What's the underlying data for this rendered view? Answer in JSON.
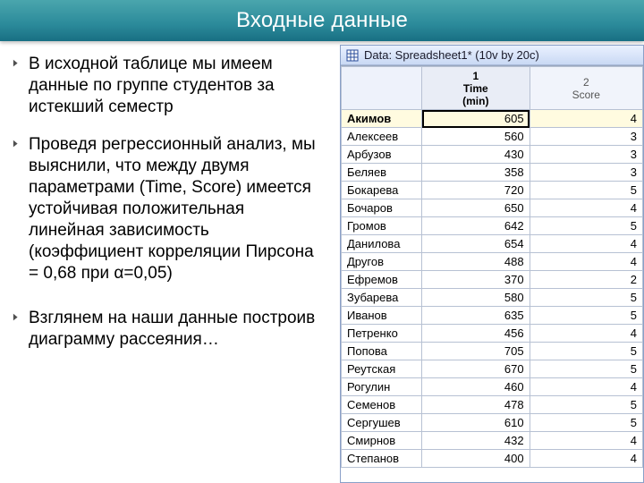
{
  "title": "Входные данные",
  "bullets": {
    "b1": "В исходной таблице мы имеем данные по группе студентов за истекший семестр",
    "b2": "Проведя регрессионный анализ, мы выяснили, что между двумя параметрами (Time, Score) имеется устойчивая положительная линейная зависимость (коэффициент корреляции Пирсона = 0,68 при α=0,05)",
    "b3": "Взглянем на наши данные построив диаграмму рассеяния…"
  },
  "window": {
    "caption": "Data: Spreadsheet1* (10v by 20c)",
    "col1_num": "1",
    "col1_label": "Time\n(min)",
    "col2_num": "2",
    "col2_label": "Score"
  },
  "rows": [
    {
      "name": "Акимов",
      "time": "605",
      "score": "4",
      "sel": true
    },
    {
      "name": "Алексеев",
      "time": "560",
      "score": "3"
    },
    {
      "name": "Арбузов",
      "time": "430",
      "score": "3"
    },
    {
      "name": "Беляев",
      "time": "358",
      "score": "3"
    },
    {
      "name": "Бокарева",
      "time": "720",
      "score": "5"
    },
    {
      "name": "Бочаров",
      "time": "650",
      "score": "4"
    },
    {
      "name": "Громов",
      "time": "642",
      "score": "5"
    },
    {
      "name": "Данилова",
      "time": "654",
      "score": "4"
    },
    {
      "name": "Другов",
      "time": "488",
      "score": "4"
    },
    {
      "name": "Ефремов",
      "time": "370",
      "score": "2"
    },
    {
      "name": "Зубарева",
      "time": "580",
      "score": "5"
    },
    {
      "name": "Иванов",
      "time": "635",
      "score": "5"
    },
    {
      "name": "Петренко",
      "time": "456",
      "score": "4"
    },
    {
      "name": "Попова",
      "time": "705",
      "score": "5"
    },
    {
      "name": "Реутская",
      "time": "670",
      "score": "5"
    },
    {
      "name": "Рогулин",
      "time": "460",
      "score": "4"
    },
    {
      "name": "Семенов",
      "time": "478",
      "score": "5"
    },
    {
      "name": "Сергушев",
      "time": "610",
      "score": "5"
    },
    {
      "name": "Смирнов",
      "time": "432",
      "score": "4"
    },
    {
      "name": "Степанов",
      "time": "400",
      "score": "4"
    }
  ]
}
